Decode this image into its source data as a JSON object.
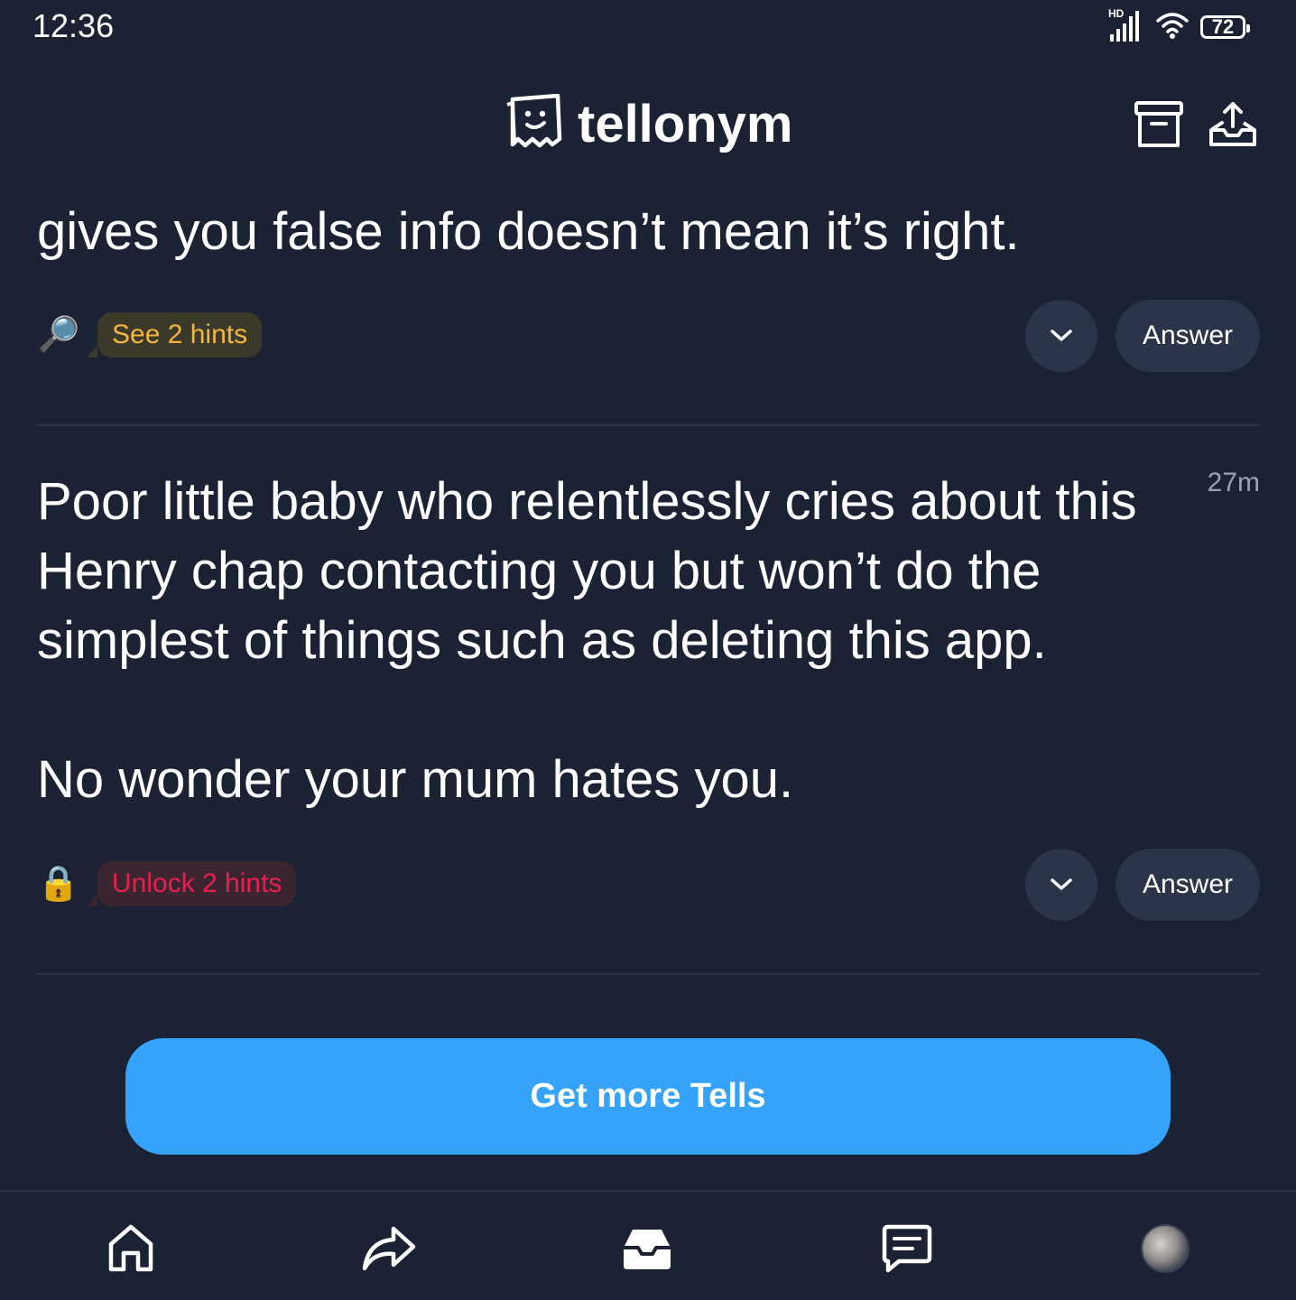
{
  "status_bar": {
    "time": "12:36",
    "network_label": "HD",
    "battery": "72"
  },
  "header": {
    "brand": "tellonym",
    "actions": [
      "archive-icon",
      "share-inbox-icon"
    ]
  },
  "tells": [
    {
      "text": "gives you false info doesn’t mean it’s right.",
      "hint_emoji": "🔎",
      "hint_label": "See 2 hints",
      "answer_label": "Answer"
    },
    {
      "time": "27m",
      "text": "Poor little baby who relentlessly cries about this\nHenry chap contacting you but won’t do the\nsimplest of things such as deleting this app.\n\nNo wonder your mum hates you.",
      "hint_emoji": "🔒",
      "hint_label": "Unlock 2 hints",
      "answer_label": "Answer"
    }
  ],
  "cta": {
    "label": "Get more Tells"
  },
  "bottom_nav": [
    "home-icon",
    "share-icon",
    "inbox-icon",
    "chat-icon",
    "profile-avatar"
  ],
  "colors": {
    "background": "#1b2233",
    "button": "#2b3549",
    "cta": "#36a3fb",
    "hint_see": "#f4b53f",
    "hint_unlock": "#ea1f4f"
  }
}
